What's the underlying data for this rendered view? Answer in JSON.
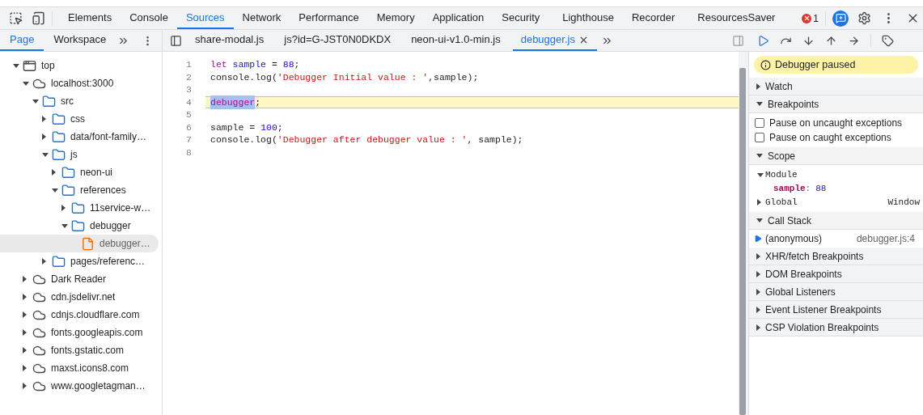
{
  "main_tabs": [
    {
      "label": "Elements",
      "selected": false
    },
    {
      "label": "Console",
      "selected": false
    },
    {
      "label": "Sources",
      "selected": true
    },
    {
      "label": "Network",
      "selected": false
    },
    {
      "label": "Performance",
      "selected": false
    },
    {
      "label": "Memory",
      "selected": false
    },
    {
      "label": "Application",
      "selected": false
    },
    {
      "label": "Security",
      "selected": false
    },
    {
      "label": "Lighthouse",
      "selected": false
    },
    {
      "label": "Recorder",
      "selected": false
    },
    {
      "label": "ResourcesSaver",
      "selected": false
    }
  ],
  "error_count": "1",
  "navigator_tabs": [
    {
      "label": "Page",
      "selected": true
    },
    {
      "label": "Workspace",
      "selected": false
    }
  ],
  "file_tabs": [
    {
      "label": "share-modal.js",
      "selected": false
    },
    {
      "label": "js?id=G-JST0N0DKDX",
      "selected": false
    },
    {
      "label": "neon-ui-v1.0-min.js",
      "selected": false
    },
    {
      "label": "debugger.js",
      "selected": true
    }
  ],
  "tree": [
    {
      "label": "top",
      "kind": "frame",
      "expanded": true,
      "selected": false,
      "children": [
        {
          "label": "localhost:3000",
          "kind": "cloud",
          "expanded": true,
          "selected": false,
          "children": [
            {
              "label": "src",
              "kind": "folder",
              "expanded": true,
              "selected": false,
              "children": [
                {
                  "label": "css",
                  "kind": "folder",
                  "expanded": false,
                  "selected": false
                },
                {
                  "label": "data/font-family…",
                  "kind": "folder",
                  "expanded": false,
                  "selected": false
                },
                {
                  "label": "js",
                  "kind": "folder",
                  "expanded": true,
                  "selected": false,
                  "children": [
                    {
                      "label": "neon-ui",
                      "kind": "folder",
                      "expanded": false,
                      "selected": false
                    },
                    {
                      "label": "references",
                      "kind": "folder",
                      "expanded": true,
                      "selected": false,
                      "children": [
                        {
                          "label": "11service-w…",
                          "kind": "folder",
                          "expanded": false,
                          "selected": false
                        },
                        {
                          "label": "debugger",
                          "kind": "folder",
                          "expanded": true,
                          "selected": false,
                          "children": [
                            {
                              "label": "debugger…",
                              "kind": "file",
                              "expanded": false,
                              "selected": true
                            }
                          ]
                        }
                      ]
                    }
                  ]
                },
                {
                  "label": "pages/referenc…",
                  "kind": "folder",
                  "expanded": false,
                  "selected": false
                }
              ]
            }
          ]
        },
        {
          "label": "Dark Reader",
          "kind": "cloud",
          "expanded": false,
          "selected": false
        },
        {
          "label": "cdn.jsdelivr.net",
          "kind": "cloud",
          "expanded": false,
          "selected": false
        },
        {
          "label": "cdnjs.cloudflare.com",
          "kind": "cloud",
          "expanded": false,
          "selected": false
        },
        {
          "label": "fonts.googleapis.com",
          "kind": "cloud",
          "expanded": false,
          "selected": false
        },
        {
          "label": "fonts.gstatic.com",
          "kind": "cloud",
          "expanded": false,
          "selected": false
        },
        {
          "label": "maxst.icons8.com",
          "kind": "cloud",
          "expanded": false,
          "selected": false
        },
        {
          "label": "www.googletagman…",
          "kind": "cloud",
          "expanded": false,
          "selected": false
        }
      ]
    }
  ],
  "code_lines": [
    {
      "number": "1",
      "paused": false,
      "tokens": [
        {
          "text": "let",
          "kind": "keyword",
          "selected": false
        },
        {
          "text": "sample",
          "kind": "variable",
          "selected": false,
          "gap_before": true
        },
        {
          "text": " = ",
          "kind": "plain",
          "selected": false
        },
        {
          "text": "88",
          "kind": "number",
          "selected": false
        },
        {
          "text": ";",
          "kind": "plain",
          "selected": false
        }
      ]
    },
    {
      "number": "2",
      "paused": false,
      "tokens": [
        {
          "text": "console.log(",
          "kind": "plain",
          "selected": false
        },
        {
          "text": "'Debugger Initial value : '",
          "kind": "string",
          "selected": false
        },
        {
          "text": ",sample);",
          "kind": "plain",
          "selected": false
        }
      ]
    },
    {
      "number": "3",
      "paused": false
    },
    {
      "number": "4",
      "paused": true,
      "tokens": [
        {
          "text": "debugger",
          "kind": "keyword",
          "selected": true
        },
        {
          "text": ";",
          "kind": "plain",
          "selected": false
        }
      ]
    },
    {
      "number": "5",
      "paused": false
    },
    {
      "number": "6",
      "paused": false,
      "tokens": [
        {
          "text": "sample = ",
          "kind": "plain",
          "selected": false
        },
        {
          "text": "100",
          "kind": "number",
          "selected": false
        },
        {
          "text": ";",
          "kind": "plain",
          "selected": false
        }
      ]
    },
    {
      "number": "7",
      "paused": false,
      "tokens": [
        {
          "text": "console.log(",
          "kind": "plain",
          "selected": false
        },
        {
          "text": "'Debugger after debugger value : '",
          "kind": "string",
          "selected": false
        },
        {
          "text": ", sample);",
          "kind": "plain",
          "selected": false
        }
      ]
    },
    {
      "number": "8",
      "paused": false
    }
  ],
  "paused_banner": "Debugger paused",
  "sections": [
    {
      "title": "Watch",
      "expanded": false
    },
    {
      "title": "Breakpoints",
      "kind": "checkboxes",
      "expanded": true,
      "items": [
        {
          "label": "Pause on uncaught exceptions",
          "checked": false
        },
        {
          "label": "Pause on caught exceptions",
          "checked": false
        }
      ]
    },
    {
      "title": "Scope",
      "kind": "scope",
      "expanded": true,
      "scopes": [
        {
          "label": "Module",
          "expanded": true,
          "variables": [
            {
              "name": "sample",
              "separator": ":",
              "value": "88"
            }
          ]
        },
        {
          "label": "Global",
          "expanded": false,
          "value": "Window"
        }
      ]
    },
    {
      "title": "Call Stack",
      "kind": "stack",
      "expanded": true,
      "frames": [
        {
          "name": "(anonymous)",
          "location": "debugger.js:4",
          "selected": true
        }
      ]
    },
    {
      "title": "XHR/fetch Breakpoints",
      "expanded": false
    },
    {
      "title": "DOM Breakpoints",
      "expanded": false
    },
    {
      "title": "Global Listeners",
      "expanded": false
    },
    {
      "title": "Event Listener Breakpoints",
      "expanded": false
    },
    {
      "title": "CSP Violation Breakpoints",
      "expanded": false
    }
  ]
}
